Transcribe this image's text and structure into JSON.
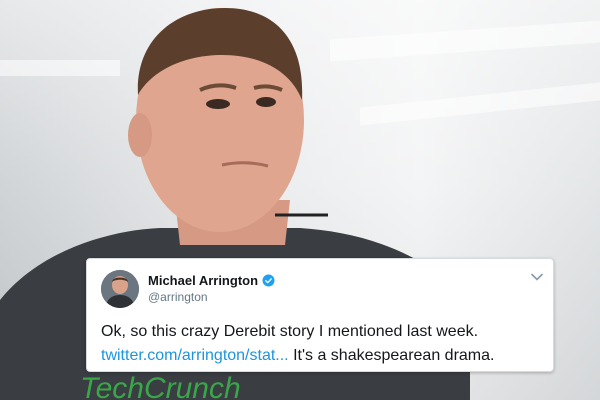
{
  "tweet": {
    "author_name": "Michael Arrington",
    "handle": "@arrington",
    "text_before": "Ok, so this crazy Derebit story I mentioned last week.",
    "link_text": "twitter.com/arrington/stat...",
    "text_after": " It's a shakespearean drama."
  },
  "shirt_logo": "TechCrunch",
  "colors": {
    "link": "#1b95e0",
    "verified": "#1da1f2",
    "shirt": "#3a3d42",
    "logo": "#3aa64a"
  },
  "icons": {
    "verified": "verified-badge-icon",
    "menu": "chevron-down-icon"
  }
}
